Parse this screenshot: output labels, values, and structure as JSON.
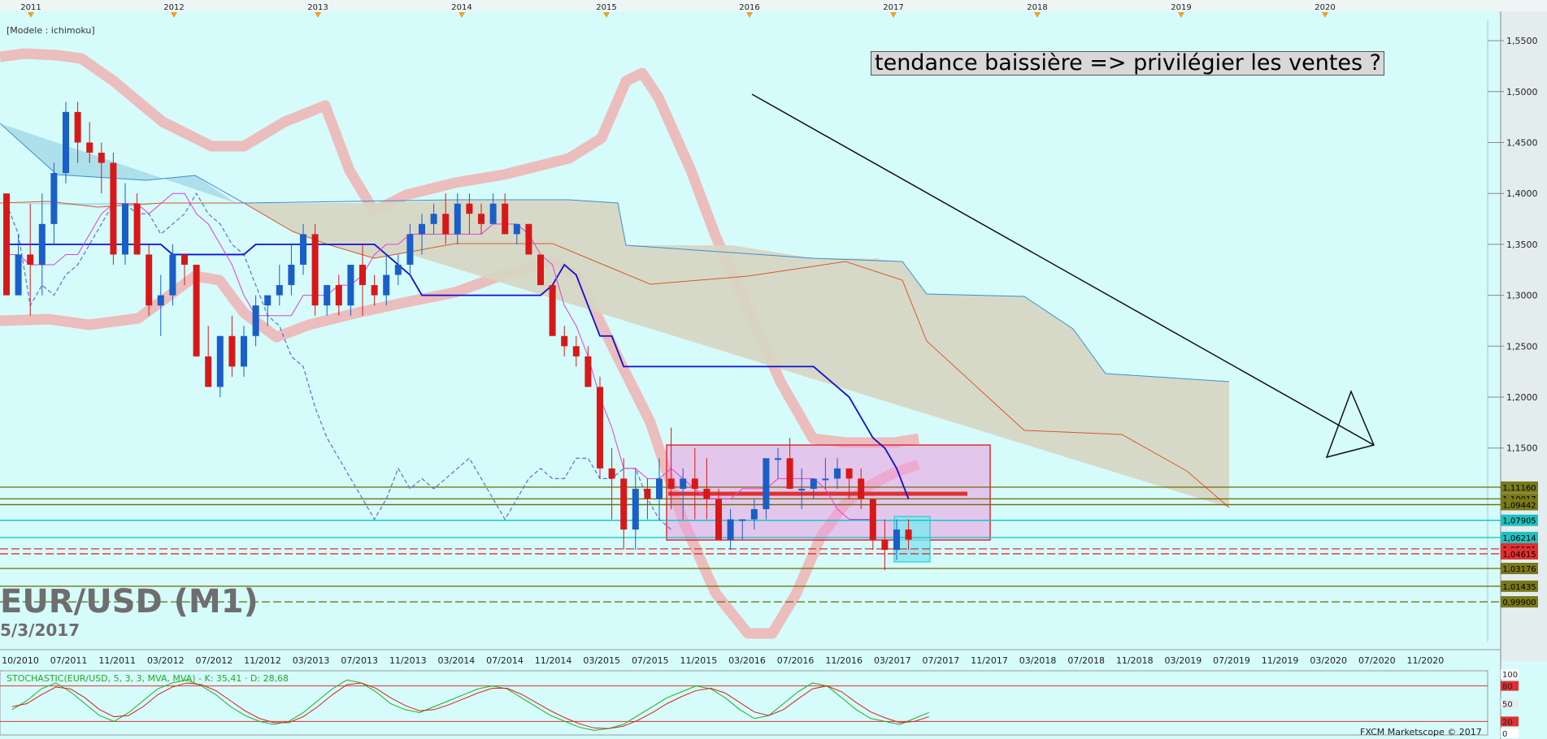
{
  "chart_data": {
    "type": "candlestick",
    "instrument_title": "EUR/USD (M1)",
    "date_label": "5/3/2017",
    "model_label": "[Modele : ichimoku]",
    "annotation": "tendance baissière => privilégier les ventes ?",
    "copyright": "FXCM Marketscope © 2017",
    "year_markers": [
      "2011",
      "2012",
      "2013",
      "2014",
      "2015",
      "2016",
      "2017",
      "2018",
      "2019",
      "2020"
    ],
    "x_tick_labels": [
      "10/2010",
      "07/2011",
      "11/2011",
      "03/2012",
      "07/2012",
      "11/2012",
      "03/2013",
      "07/2013",
      "11/2013",
      "03/2014",
      "07/2014",
      "11/2014",
      "03/2015",
      "07/2015",
      "11/2015",
      "03/2016",
      "07/2016",
      "11/2016",
      "03/2017",
      "07/2017",
      "11/2017",
      "03/2018",
      "07/2018",
      "11/2018",
      "03/2019",
      "07/2019",
      "11/2019",
      "03/2020",
      "07/2020",
      "11/2020"
    ],
    "y_ticks": [
      "1,5500",
      "1,5000",
      "1,4500",
      "1,4000",
      "1,3500",
      "1,3000",
      "1,2500",
      "1,2000",
      "1,1500"
    ],
    "ylim": [
      0.96,
      1.57
    ],
    "candles": [
      [
        1.4,
        1.4,
        1.3,
        1.3
      ],
      [
        1.3,
        1.36,
        1.3,
        1.34
      ],
      [
        1.34,
        1.39,
        1.28,
        1.33
      ],
      [
        1.33,
        1.4,
        1.3,
        1.37
      ],
      [
        1.37,
        1.43,
        1.35,
        1.42
      ],
      [
        1.42,
        1.49,
        1.41,
        1.48
      ],
      [
        1.48,
        1.49,
        1.43,
        1.45
      ],
      [
        1.45,
        1.47,
        1.43,
        1.44
      ],
      [
        1.44,
        1.45,
        1.4,
        1.43
      ],
      [
        1.43,
        1.44,
        1.33,
        1.34
      ],
      [
        1.34,
        1.41,
        1.33,
        1.39
      ],
      [
        1.39,
        1.4,
        1.34,
        1.34
      ],
      [
        1.34,
        1.35,
        1.28,
        1.29
      ],
      [
        1.29,
        1.32,
        1.26,
        1.3
      ],
      [
        1.3,
        1.35,
        1.29,
        1.34
      ],
      [
        1.34,
        1.34,
        1.31,
        1.33
      ],
      [
        1.33,
        1.33,
        1.26,
        1.24
      ],
      [
        1.24,
        1.27,
        1.21,
        1.21
      ],
      [
        1.21,
        1.26,
        1.2,
        1.26
      ],
      [
        1.26,
        1.28,
        1.22,
        1.23
      ],
      [
        1.23,
        1.27,
        1.22,
        1.26
      ],
      [
        1.26,
        1.3,
        1.25,
        1.29
      ],
      [
        1.29,
        1.3,
        1.27,
        1.3
      ],
      [
        1.3,
        1.33,
        1.29,
        1.31
      ],
      [
        1.31,
        1.35,
        1.3,
        1.33
      ],
      [
        1.33,
        1.37,
        1.32,
        1.36
      ],
      [
        1.36,
        1.37,
        1.28,
        1.29
      ],
      [
        1.29,
        1.31,
        1.28,
        1.31
      ],
      [
        1.31,
        1.32,
        1.28,
        1.29
      ],
      [
        1.29,
        1.33,
        1.28,
        1.33
      ],
      [
        1.33,
        1.35,
        1.28,
        1.31
      ],
      [
        1.31,
        1.32,
        1.29,
        1.3
      ],
      [
        1.3,
        1.34,
        1.29,
        1.32
      ],
      [
        1.32,
        1.34,
        1.31,
        1.33
      ],
      [
        1.33,
        1.37,
        1.32,
        1.36
      ],
      [
        1.36,
        1.38,
        1.34,
        1.37
      ],
      [
        1.37,
        1.39,
        1.36,
        1.38
      ],
      [
        1.38,
        1.4,
        1.35,
        1.36
      ],
      [
        1.36,
        1.4,
        1.35,
        1.39
      ],
      [
        1.39,
        1.4,
        1.36,
        1.38
      ],
      [
        1.38,
        1.39,
        1.36,
        1.37
      ],
      [
        1.37,
        1.4,
        1.37,
        1.39
      ],
      [
        1.39,
        1.4,
        1.36,
        1.36
      ],
      [
        1.36,
        1.37,
        1.35,
        1.37
      ],
      [
        1.37,
        1.37,
        1.34,
        1.34
      ],
      [
        1.34,
        1.34,
        1.31,
        1.31
      ],
      [
        1.31,
        1.31,
        1.27,
        1.26
      ],
      [
        1.26,
        1.27,
        1.24,
        1.25
      ],
      [
        1.25,
        1.26,
        1.23,
        1.24
      ],
      [
        1.24,
        1.25,
        1.21,
        1.21
      ],
      [
        1.21,
        1.22,
        1.12,
        1.13
      ],
      [
        1.13,
        1.15,
        1.08,
        1.12
      ],
      [
        1.12,
        1.14,
        1.05,
        1.07
      ],
      [
        1.07,
        1.13,
        1.05,
        1.11
      ],
      [
        1.11,
        1.12,
        1.08,
        1.1
      ],
      [
        1.1,
        1.14,
        1.08,
        1.12
      ],
      [
        1.12,
        1.17,
        1.09,
        1.11
      ],
      [
        1.11,
        1.13,
        1.08,
        1.12
      ],
      [
        1.12,
        1.15,
        1.08,
        1.11
      ],
      [
        1.11,
        1.14,
        1.08,
        1.1
      ],
      [
        1.1,
        1.11,
        1.07,
        1.06
      ],
      [
        1.06,
        1.09,
        1.05,
        1.08
      ],
      [
        1.08,
        1.08,
        1.06,
        1.08
      ],
      [
        1.08,
        1.1,
        1.07,
        1.09
      ],
      [
        1.09,
        1.14,
        1.08,
        1.14
      ],
      [
        1.14,
        1.15,
        1.12,
        1.14
      ],
      [
        1.14,
        1.16,
        1.11,
        1.11
      ],
      [
        1.11,
        1.13,
        1.09,
        1.11
      ],
      [
        1.11,
        1.12,
        1.1,
        1.12
      ],
      [
        1.12,
        1.14,
        1.11,
        1.12
      ],
      [
        1.12,
        1.14,
        1.11,
        1.13
      ],
      [
        1.13,
        1.13,
        1.1,
        1.12
      ],
      [
        1.12,
        1.13,
        1.09,
        1.1
      ],
      [
        1.1,
        1.1,
        1.05,
        1.06
      ],
      [
        1.06,
        1.08,
        1.03,
        1.05
      ],
      [
        1.05,
        1.08,
        1.04,
        1.07
      ],
      [
        1.07,
        1.08,
        1.05,
        1.06
      ]
    ],
    "kijun": [
      1.35,
      1.35,
      1.35,
      1.35,
      1.35,
      1.35,
      1.35,
      1.35,
      1.35,
      1.35,
      1.35,
      1.35,
      1.35,
      1.35,
      1.34,
      1.34,
      1.34,
      1.34,
      1.34,
      1.34,
      1.34,
      1.35,
      1.35,
      1.35,
      1.35,
      1.35,
      1.35,
      1.35,
      1.35,
      1.35,
      1.35,
      1.35,
      1.34,
      1.33,
      1.32,
      1.3,
      1.3,
      1.3,
      1.3,
      1.3,
      1.3,
      1.3,
      1.3,
      1.3,
      1.3,
      1.3,
      1.31,
      1.33,
      1.32,
      1.29,
      1.26,
      1.26,
      1.23,
      1.23,
      1.23,
      1.23,
      1.23,
      1.23,
      1.23,
      1.23,
      1.23,
      1.23,
      1.23,
      1.23,
      1.23,
      1.23,
      1.23,
      1.23,
      1.23,
      1.22,
      1.21,
      1.2,
      1.18,
      1.16,
      1.15,
      1.13,
      1.1
    ],
    "tenkan": [
      1.34,
      1.34,
      1.33,
      1.33,
      1.33,
      1.34,
      1.34,
      1.36,
      1.38,
      1.39,
      1.39,
      1.39,
      1.38,
      1.39,
      1.4,
      1.4,
      1.38,
      1.37,
      1.35,
      1.33,
      1.3,
      1.28,
      1.28,
      1.28,
      1.28,
      1.3,
      1.3,
      1.3,
      1.31,
      1.31,
      1.32,
      1.34,
      1.35,
      1.35,
      1.36,
      1.36,
      1.36,
      1.36,
      1.36,
      1.36,
      1.36,
      1.37,
      1.37,
      1.37,
      1.36,
      1.34,
      1.33,
      1.29,
      1.27,
      1.24,
      1.2,
      1.17,
      1.13,
      1.13,
      1.12,
      1.12,
      1.13,
      1.12,
      1.11,
      1.1,
      1.1,
      1.1,
      1.11,
      1.11,
      1.11,
      1.12,
      1.12,
      1.12,
      1.12,
      1.11,
      1.09,
      1.08,
      1.08,
      1.08
    ],
    "chikou": [
      1.39,
      1.36,
      1.29,
      1.31,
      1.3,
      1.32,
      1.33,
      1.35,
      1.37,
      1.39,
      1.39,
      1.38,
      1.38,
      1.36,
      1.37,
      1.38,
      1.4,
      1.38,
      1.37,
      1.35,
      1.34,
      1.31,
      1.28,
      1.27,
      1.24,
      1.23,
      1.19,
      1.16,
      1.14,
      1.12,
      1.1,
      1.08,
      1.1,
      1.13,
      1.11,
      1.12,
      1.11,
      1.12,
      1.13,
      1.14,
      1.12,
      1.1,
      1.08,
      1.1,
      1.12,
      1.13,
      1.12,
      1.12,
      1.14,
      1.14,
      1.12,
      1.12,
      1.13,
      1.13,
      1.1,
      1.08,
      1.07
    ],
    "levels": [
      {
        "value": "1,11160",
        "color": "#6b6b00",
        "bg": "#7a7a1a"
      },
      {
        "value": "1,10017",
        "color": "#6b6b00",
        "bg": "#7a7a1a"
      },
      {
        "value": "1,09442",
        "color": "#6b6b00",
        "bg": "#7a7a1a"
      },
      {
        "value": "1,07905",
        "color": "#00c8c8",
        "bg": "#20c0c0"
      },
      {
        "value": "1,06214",
        "color": "#00c8c8",
        "bg": "#20c0c0"
      },
      {
        "value": "1,05101",
        "color": "#e03030",
        "bg": "#e03030"
      },
      {
        "value": "1,04615",
        "color": "#e03030",
        "bg": "#e03030"
      },
      {
        "value": "1,03176",
        "color": "#6b6b00",
        "bg": "#7a7a1a"
      },
      {
        "value": "1,01435",
        "color": "#6b6b00",
        "bg": "#7a7a1a"
      },
      {
        "value": "0,99900",
        "color": "#6b6b00",
        "bg": "#7a7a1a"
      }
    ],
    "stochastic": {
      "label": "STOCHASTIC(EUR/USD, 5, 3, 3, MVA, MVA) - K: 35,41 · D: 28,68",
      "scale": [
        "100",
        "80",
        "50",
        "20",
        "0"
      ],
      "k": [
        40,
        55,
        75,
        85,
        70,
        50,
        30,
        20,
        35,
        55,
        75,
        85,
        90,
        80,
        65,
        45,
        30,
        20,
        15,
        20,
        35,
        55,
        75,
        90,
        85,
        70,
        50,
        40,
        35,
        45,
        55,
        65,
        75,
        80,
        75,
        60,
        45,
        30,
        20,
        10,
        5,
        8,
        15,
        30,
        45,
        60,
        70,
        80,
        75,
        60,
        40,
        25,
        30,
        50,
        70,
        85,
        80,
        60,
        40,
        25,
        20,
        15,
        25,
        35
      ],
      "d": [
        45,
        50,
        65,
        78,
        75,
        60,
        40,
        28,
        30,
        45,
        65,
        78,
        85,
        82,
        72,
        55,
        38,
        25,
        18,
        18,
        28,
        45,
        65,
        82,
        85,
        76,
        60,
        47,
        38,
        40,
        48,
        58,
        68,
        76,
        76,
        66,
        52,
        38,
        26,
        16,
        9,
        8,
        12,
        22,
        35,
        50,
        62,
        72,
        76,
        68,
        52,
        36,
        30,
        40,
        58,
        75,
        80,
        70,
        52,
        36,
        26,
        18,
        20,
        28
      ]
    }
  }
}
